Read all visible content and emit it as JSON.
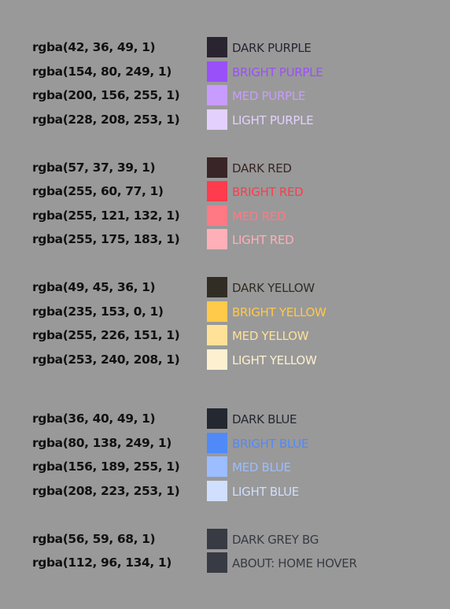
{
  "colors": [
    {
      "code": "rgba(42, 36, 49, 1)",
      "label": "DARK PURPLE",
      "swatch": "#2a2431",
      "text": "#2a2431"
    },
    {
      "code": "rgba(154, 80, 249, 1)",
      "label": "BRIGHT PURPLE",
      "swatch": "#9a50f9",
      "text": "#9a50f9"
    },
    {
      "code": "rgba(200, 156, 255, 1)",
      "label": "MED PURPLE",
      "swatch": "#c89cff",
      "text": "#c89cff"
    },
    {
      "code": "rgba(228, 208, 253, 1)",
      "label": "LIGHT PURPLE",
      "swatch": "#e4d0fd",
      "text": "#e4d0fd"
    },
    {
      "code": "rgba(57, 37, 39, 1)",
      "label": "DARK RED",
      "swatch": "#392527",
      "text": "#392527"
    },
    {
      "code": "rgba(255, 60, 77, 1)",
      "label": "BRIGHT RED",
      "swatch": "#ff3c4d",
      "text": "#ff3c4d"
    },
    {
      "code": "rgba(255, 121, 132, 1)",
      "label": "MED RED",
      "swatch": "#ff7984",
      "text": "#ff7984"
    },
    {
      "code": "rgba(255, 175, 183, 1)",
      "label": "LIGHT RED",
      "swatch": "#ffafb7",
      "text": "#ffafb7"
    },
    {
      "code": "rgba(49, 45, 36, 1)",
      "label": "DARK YELLOW",
      "swatch": "#312d24",
      "text": "#312d24"
    },
    {
      "code": "rgba(235, 153, 0, 1)",
      "label": "BRIGHT YELLOW",
      "swatch": "#ffc94a",
      "text": "#ffc94a"
    },
    {
      "code": "rgba(255, 226, 151, 1)",
      "label": "MED YELLOW",
      "swatch": "#ffe297",
      "text": "#ffe297"
    },
    {
      "code": "rgba(253, 240, 208, 1)",
      "label": "LIGHT YELLOW",
      "swatch": "#fdf0d0",
      "text": "#fdf0d0"
    },
    {
      "code": "rgba(36, 40, 49, 1)",
      "label": "DARK BLUE",
      "swatch": "#242831",
      "text": "#242831"
    },
    {
      "code": "rgba(80, 138, 249, 1)",
      "label": "BRIGHT BLUE",
      "swatch": "#508af9",
      "text": "#508af9"
    },
    {
      "code": "rgba(156, 189, 255, 1)",
      "label": "MED BLUE",
      "swatch": "#9cbdff",
      "text": "#9cbdff"
    },
    {
      "code": "rgba(208, 223, 253, 1)",
      "label": "LIGHT BLUE",
      "swatch": "#d0dffd",
      "text": "#d0dffd"
    },
    {
      "code": "rgba(56, 59, 68, 1)",
      "label": "DARK GREY BG",
      "swatch": "#383b44",
      "text": "#383b44"
    },
    {
      "code": "rgba(112, 96, 134, 1)",
      "label": "ABOUT: HOME HOVER",
      "swatch": "#383b44",
      "text": "#383b44"
    }
  ]
}
